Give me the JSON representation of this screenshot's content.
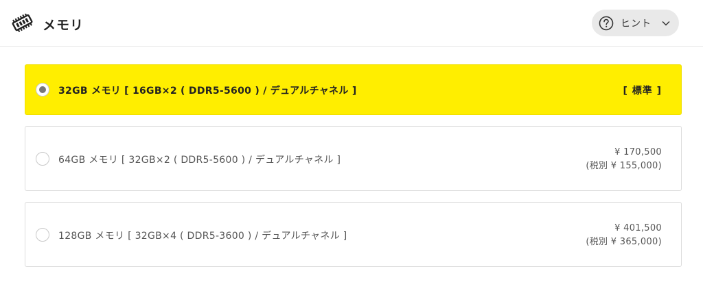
{
  "header": {
    "title": "メモリ",
    "icon": "memory-chip-icon",
    "hint_label": "ヒント",
    "hint_icon": "question-circle-icon",
    "hint_chevron": "chevron-down-icon"
  },
  "colors": {
    "selected_bg": "#ffee00",
    "border": "#dcdcdc",
    "hint_bg": "#e9e9e9"
  },
  "options": [
    {
      "label": "32GB メモリ [ 16GB×2 ( DDR5-5600 ) / デュアルチャネル ]",
      "badge": "[ 標準 ]",
      "selected": true
    },
    {
      "label": "64GB メモリ [ 32GB×2 ( DDR5-5600 ) / デュアルチャネル ]",
      "price": "¥ 170,500",
      "price_ex_tax": "(税別 ¥ 155,000)",
      "selected": false
    },
    {
      "label": "128GB メモリ [ 32GB×4 ( DDR5-3600 ) / デュアルチャネル ]",
      "price": "¥ 401,500",
      "price_ex_tax": "(税別 ¥ 365,000)",
      "selected": false
    }
  ]
}
